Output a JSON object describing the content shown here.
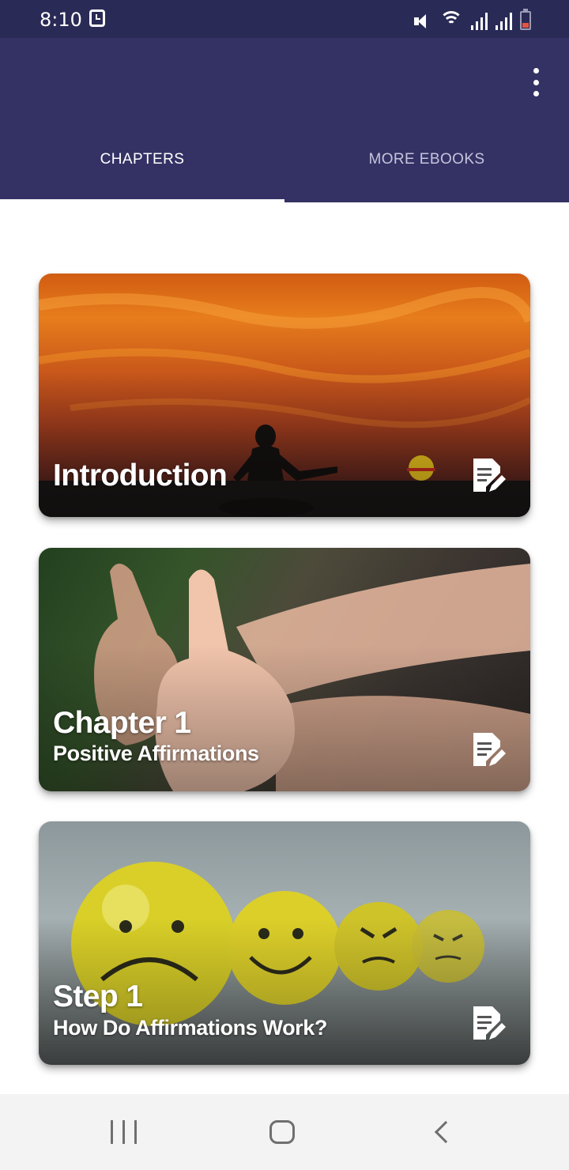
{
  "status_bar": {
    "time": "8:10",
    "icons": [
      "alarm-icon",
      "mute-icon",
      "wifi-icon",
      "signal-icon",
      "signal-icon",
      "battery-icon"
    ],
    "battery_color": "#e2543f"
  },
  "app_bar": {
    "background": "#343264",
    "tabs": [
      {
        "label": "CHAPTERS",
        "active": true
      },
      {
        "label": "MORE EBOOKS",
        "active": false
      }
    ]
  },
  "chapters": [
    {
      "title": "Introduction",
      "subtitle": "",
      "image": "meditation-sunset",
      "icon": "document-edit-icon"
    },
    {
      "title": "Chapter 1",
      "subtitle": "Positive Affirmations",
      "image": "thumbs-up-hands",
      "icon": "document-edit-icon"
    },
    {
      "title": "Step 1",
      "subtitle": "How Do Affirmations Work?",
      "image": "emoji-balls",
      "icon": "document-edit-icon"
    }
  ],
  "nav_bar": {
    "buttons": [
      "recents-icon",
      "home-icon",
      "back-icon"
    ]
  }
}
